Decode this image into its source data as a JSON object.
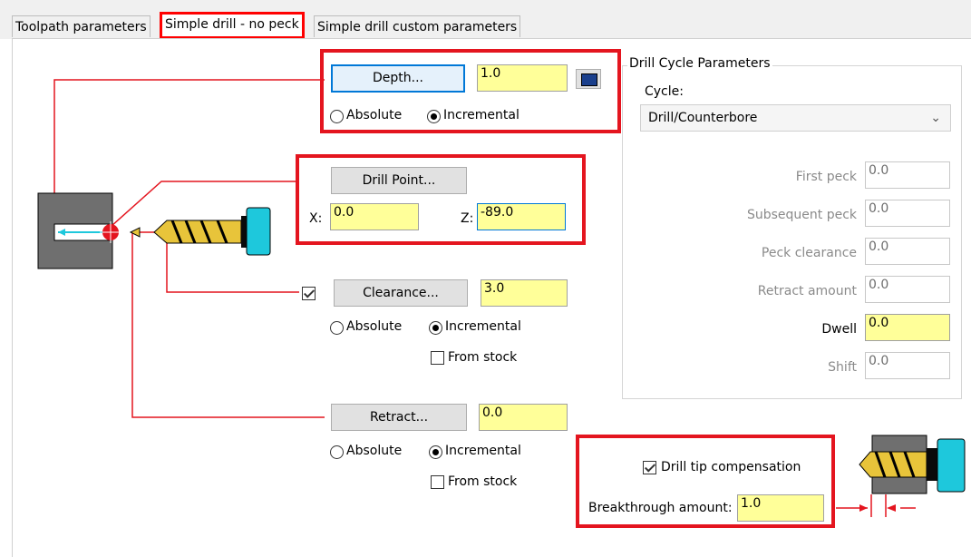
{
  "tabs": [
    "Toolpath parameters",
    "Simple drill - no peck",
    "Simple drill custom parameters"
  ],
  "depth": {
    "button": "Depth...",
    "value": "1.0",
    "absolute": "Absolute",
    "incremental": "Incremental"
  },
  "drill_point": {
    "button": "Drill Point...",
    "x_label": "X:",
    "x_value": "0.0",
    "z_label": "Z:",
    "z_value": "-89.0"
  },
  "clearance": {
    "button": "Clearance...",
    "value": "3.0",
    "absolute": "Absolute",
    "incremental": "Incremental",
    "from_stock": "From stock"
  },
  "retract": {
    "button": "Retract...",
    "value": "0.0",
    "absolute": "Absolute",
    "incremental": "Incremental",
    "from_stock": "From stock"
  },
  "drill_cycle": {
    "title": "Drill Cycle Parameters",
    "cycle_label": "Cycle:",
    "cycle_value": "Drill/Counterbore",
    "params": [
      {
        "label": "First peck",
        "value": "0.0"
      },
      {
        "label": "Subsequent peck",
        "value": "0.0"
      },
      {
        "label": "Peck clearance",
        "value": "0.0"
      },
      {
        "label": "Retract amount",
        "value": "0.0"
      },
      {
        "label": "Dwell",
        "value": "0.0"
      },
      {
        "label": "Shift",
        "value": "0.0"
      }
    ]
  },
  "tip": {
    "compensation": "Drill tip compensation",
    "breakthrough_label": "Breakthrough amount:",
    "breakthrough_value": "1.0"
  },
  "colors": {
    "highlight_red": "#e4151f",
    "field_yellow": "#ffff99",
    "drill_gold": "#e8c43a",
    "holder_cyan": "#1ec8dc",
    "stock_gray": "#6f6f6f",
    "focus_blue": "#0078d7"
  }
}
